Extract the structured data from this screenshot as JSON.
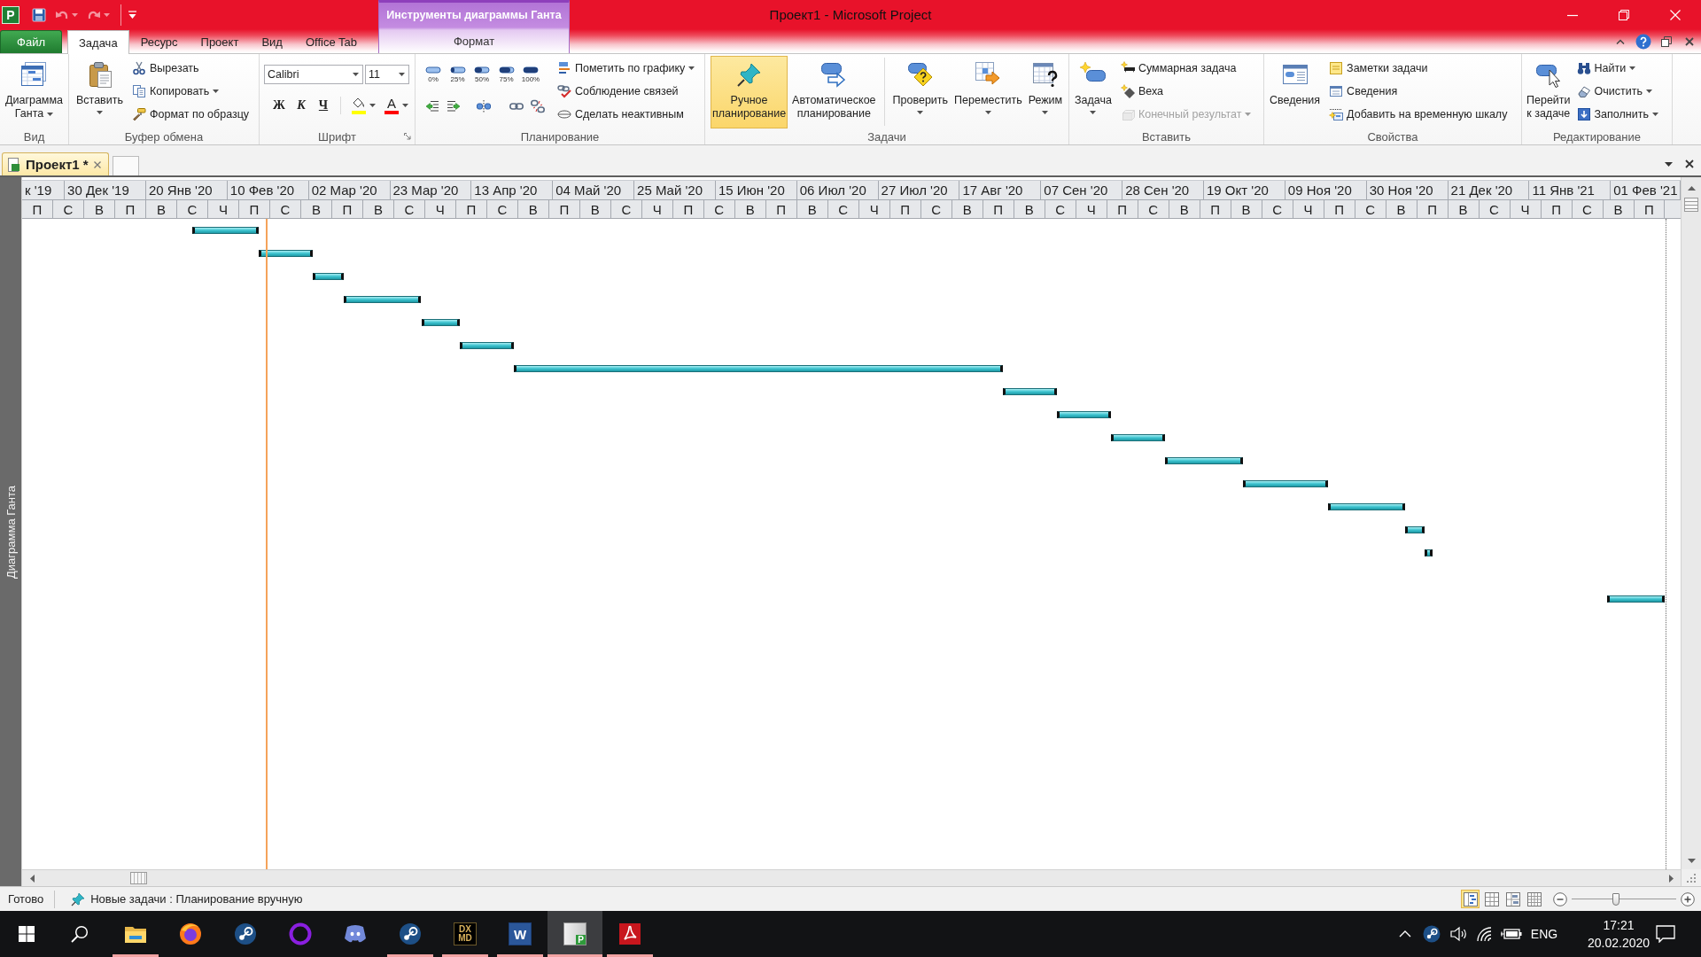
{
  "window": {
    "title": "Проект1 - Microsoft Project",
    "app_icon_letter": "P"
  },
  "quick_access": [
    {
      "disabled": false,
      "dropdown": false
    },
    {
      "disabled": true,
      "dropdown": true
    },
    {
      "disabled": true,
      "dropdown": true
    },
    {
      "disabled": false,
      "dropdown": false
    }
  ],
  "contextual_group": {
    "title": "Инструменты диаграммы Ганта"
  },
  "ribbon_tabs": [
    {
      "label": "Файл",
      "kind": "file",
      "selected": false
    },
    {
      "label": "Задача",
      "kind": "normal",
      "selected": true
    },
    {
      "label": "Ресурс",
      "kind": "normal",
      "selected": false
    },
    {
      "label": "Проект",
      "kind": "normal",
      "selected": false
    },
    {
      "label": "Вид",
      "kind": "normal",
      "selected": false
    },
    {
      "label": "Office Tab",
      "kind": "normal",
      "selected": false
    },
    {
      "label": "Формат",
      "kind": "contextual",
      "selected": false
    }
  ],
  "ribbon_groups": [
    {
      "title": "Вид",
      "kind": "buttons",
      "items": [
        {
          "kind": "large",
          "label": "Диаграмма Ганта",
          "dropdown": true
        }
      ]
    },
    {
      "title": "Буфер обмена",
      "kind": "buttons",
      "items": [
        {
          "kind": "large",
          "label": "Вставить",
          "dropdown": true
        },
        {
          "kind": "small",
          "label": "Вырезать",
          "dropdown": false
        },
        {
          "kind": "small",
          "label": "Копировать",
          "dropdown": true
        },
        {
          "kind": "small",
          "label": "Формат по образцу",
          "dropdown": false
        }
      ]
    },
    {
      "title": "Шрифт",
      "kind": "font",
      "dialog_launcher": true,
      "font_field": {
        "value": "Calibri"
      },
      "size_field": {
        "value": "11"
      },
      "style_buttons": [
        "Ж",
        "К",
        "Ч"
      ],
      "color_buttons": [
        {
          "kind": "fill",
          "color": "#ffff00",
          "dropdown": true
        },
        {
          "kind": "text",
          "label": "A",
          "color": "#ff0000",
          "dropdown": true
        }
      ]
    },
    {
      "title": "Планирование",
      "kind": "scheduling",
      "progress": [
        "0%",
        "25%",
        "50%",
        "75%",
        "100%"
      ],
      "items": [
        {
          "kind": "small",
          "label": "Пометить по графику",
          "dropdown": true
        },
        {
          "kind": "small",
          "label": "Соблюдение связей",
          "dropdown": false
        },
        {
          "kind": "small",
          "label": "Сделать неактивным",
          "dropdown": false
        }
      ]
    },
    {
      "title": "Задачи",
      "kind": "buttons",
      "items": [
        {
          "kind": "large",
          "label": "Ручное планирование",
          "dropdown": false,
          "selected": true
        },
        {
          "kind": "large",
          "label": "Автоматическое планирование",
          "dropdown": false,
          "selected": false
        },
        {
          "kind": "large",
          "label": "Проверить",
          "dropdown": true,
          "selected": false
        },
        {
          "kind": "large",
          "label": "Переместить",
          "dropdown": true,
          "selected": false
        },
        {
          "kind": "large",
          "label": "Режим",
          "dropdown": true,
          "selected": false
        }
      ]
    },
    {
      "title": "Вставить",
      "kind": "buttons",
      "items": [
        {
          "kind": "large",
          "label": "Задача",
          "dropdown": true,
          "disabled": false
        },
        {
          "kind": "small",
          "label": "Суммарная задача",
          "dropdown": false,
          "disabled": false
        },
        {
          "kind": "small",
          "label": "Веха",
          "dropdown": false,
          "disabled": false
        },
        {
          "kind": "small",
          "label": "Конечный результат",
          "dropdown": true,
          "disabled": true
        }
      ]
    },
    {
      "title": "Свойства",
      "kind": "buttons",
      "items": [
        {
          "kind": "large",
          "label": "Сведения",
          "dropdown": false
        },
        {
          "kind": "small",
          "label": "Заметки задачи",
          "dropdown": false
        },
        {
          "kind": "small",
          "label": "Сведения",
          "dropdown": false
        },
        {
          "kind": "small",
          "label": "Добавить на временную шкалу",
          "dropdown": false
        }
      ]
    },
    {
      "title": "Редактирование",
      "kind": "buttons",
      "items": [
        {
          "kind": "large",
          "label": "Перейти к задаче",
          "dropdown": false
        },
        {
          "kind": "small",
          "label": "Найти",
          "dropdown": true
        },
        {
          "kind": "small",
          "label": "Очистить",
          "dropdown": true
        },
        {
          "kind": "small",
          "label": "Заполнить",
          "dropdown": true
        }
      ]
    }
  ],
  "document_tabs": [
    {
      "label": "Проект1 *",
      "selected": true
    }
  ],
  "view_bar": {
    "label": "Диаграмма Ганта"
  },
  "gantt": {
    "timescale_major": [
      "к '19",
      "30 Дек '19",
      "20 Янв '20",
      "10 Фев '20",
      "02 Мар '20",
      "23 Мар '20",
      "13 Апр '20",
      "04 Май '20",
      "25 Май '20",
      "15 Июн '20",
      "06 Июл '20",
      "27 Июл '20",
      "17 Авг '20",
      "07 Сен '20",
      "28 Сен '20",
      "19 Окт '20",
      "09 Ноя '20",
      "30 Ноя '20",
      "21 Дек '20",
      "11 Янв '21",
      "01 Фев '21"
    ],
    "timescale_minor": [
      "П",
      "С",
      "В",
      "П",
      "В",
      "С",
      "Ч",
      "П",
      "С",
      "В",
      "П",
      "В",
      "С",
      "Ч",
      "П",
      "С",
      "В",
      "П",
      "В",
      "С",
      "Ч",
      "П",
      "С",
      "В",
      "П",
      "В",
      "С",
      "Ч",
      "П",
      "С",
      "В",
      "П",
      "В",
      "С",
      "Ч",
      "П",
      "С",
      "В",
      "П",
      "В",
      "С",
      "Ч",
      "П",
      "С",
      "В",
      "П",
      "В",
      "С",
      "Ч",
      "П",
      "С",
      "В",
      "П"
    ]
  },
  "status_bar": {
    "ready": "Готово",
    "new_tasks": "Новые задачи : Планирование вручную",
    "views": [
      {
        "selected": true
      },
      {
        "selected": false
      },
      {
        "selected": false
      },
      {
        "selected": false
      }
    ],
    "zoom": {
      "level": 0.42
    }
  },
  "taskbar": {
    "apps": [
      {
        "running": true,
        "selected": false
      },
      {
        "running": false,
        "selected": false
      },
      {
        "running": false,
        "selected": false
      },
      {
        "running": false,
        "selected": false
      },
      {
        "running": false,
        "selected": false
      },
      {
        "running": true,
        "selected": false
      },
      {
        "running": true,
        "selected": false,
        "icon_text": [
          "DX",
          "MD"
        ]
      },
      {
        "running": true,
        "selected": false,
        "icon_text": [
          "W"
        ]
      },
      {
        "running": true,
        "selected": true,
        "icon_text": [
          "P"
        ]
      },
      {
        "running": true,
        "selected": false
      }
    ],
    "tray": {
      "language": "ENG",
      "time": "17:21",
      "date": "20.02.2020"
    }
  }
}
